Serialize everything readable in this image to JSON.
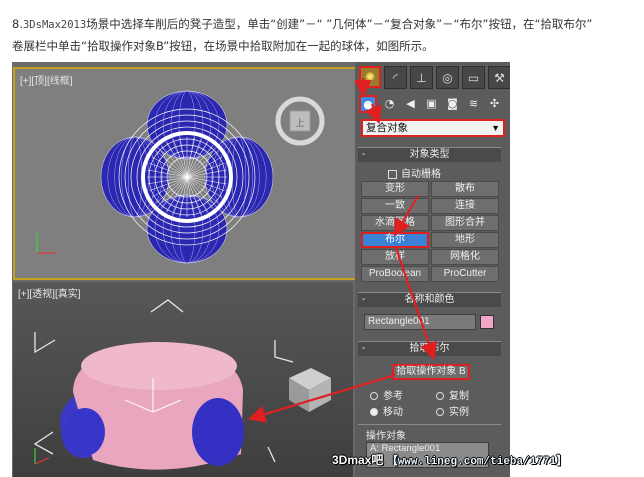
{
  "instruction": {
    "step_num": "8.",
    "app_version": "3DsMax2013",
    "line1_rest": "场景中选择车削后的凳子造型，单击“创建”－“ ”几何体”－“复合对象”－“布尔”按钮，在“拾取布尔”",
    "line2": "卷展栏中单击“拾取操作对象B”按钮，在场景中拾取附加在一起的球体，如图所示。"
  },
  "viewport_top": {
    "label": "[+][顶][线框]"
  },
  "viewport_persp": {
    "label": "[+][透视][真实]"
  },
  "panel": {
    "dropdown_value": "复合对象",
    "object_type": {
      "header": "对象类型",
      "autogrid": "自动栅格",
      "buttons": [
        "变形",
        "散布",
        "一致",
        "连接",
        "水滴网格",
        "图形合并",
        "布尔",
        "地形",
        "放样",
        "网格化",
        "ProBoolean",
        "ProCutter"
      ]
    },
    "name_color": {
      "header": "名称和颜色",
      "name_value": "Rectangle001",
      "swatch_color": "#f4a6c8"
    },
    "pick_boolean": {
      "header": "拾取布尔",
      "pick_button": "拾取操作对象 B",
      "options": [
        "参考",
        "复制",
        "移动",
        "实例"
      ],
      "selected_option": "移动"
    },
    "operands": {
      "header": "操作对象",
      "items": [
        "A: Rectangle001"
      ]
    }
  },
  "watermark": {
    "brand": "3Dmax吧",
    "url": "【www.lineg.com/tieba/1771】"
  },
  "colors": {
    "highlight_red": "#e02020",
    "selected_blue": "#3a82d6",
    "panel_bg": "#5c5c5c"
  }
}
